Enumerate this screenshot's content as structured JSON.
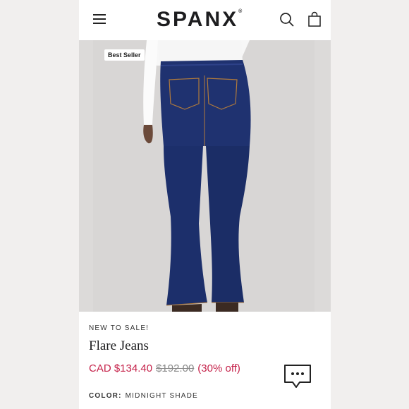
{
  "header": {
    "brand": "SPANX",
    "trademark": "®",
    "icons": [
      "menu-icon",
      "search-icon",
      "shopping-bag-icon"
    ]
  },
  "image": {
    "badge": "Best Seller"
  },
  "product": {
    "eyebrow": "NEW TO SALE!",
    "name": "Flare Jeans",
    "sale_price": "CAD $134.40",
    "original_price": "$192.00",
    "discount": "(30% off)",
    "color_label": "COLOR:",
    "color_value": "MIDNIGHT SHADE"
  },
  "chat": {
    "icon": "chat-icon"
  },
  "colors": {
    "sale": "#c5224a",
    "denim": "#1c2f6b",
    "page_bg": "#f1efee",
    "photo_bg": "#dcdad9"
  }
}
